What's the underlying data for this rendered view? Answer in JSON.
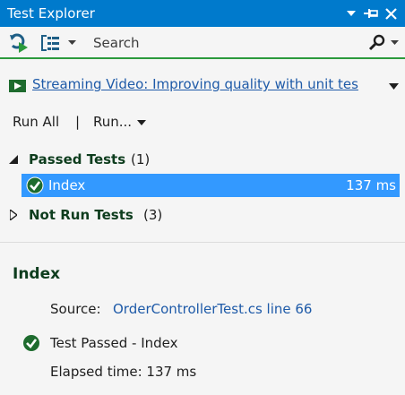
{
  "window": {
    "title": "Test Explorer",
    "accent_color": "#007acc"
  },
  "toolbar": {
    "search_placeholder": "Search",
    "accent_underline": "#2b9a3c"
  },
  "playlist": {
    "link_text": "Streaming Video: Improving quality with unit tes"
  },
  "runbar": {
    "run_all_label": "Run All",
    "separator": "|",
    "run_label": "Run..."
  },
  "groups": [
    {
      "label": "Passed Tests",
      "count": "(1)",
      "expanded": true
    },
    {
      "label": "Not Run Tests",
      "count": "(3)",
      "expanded": false
    }
  ],
  "tests": [
    {
      "name": "Index",
      "duration": "137 ms",
      "status": "passed",
      "selected": true
    }
  ],
  "detail": {
    "title": "Index",
    "source_label": "Source:",
    "source_link": "OrderControllerTest.cs line 66",
    "result_text": "Test Passed - Index",
    "elapsed_text": "Elapsed time: 137 ms"
  },
  "icons": {
    "titlebar": [
      "dropdown-icon",
      "pin-icon",
      "close-icon"
    ],
    "toolbar": [
      "run-tests-icon",
      "group-by-icon",
      "search-icon"
    ],
    "status": "passed-check-icon"
  }
}
